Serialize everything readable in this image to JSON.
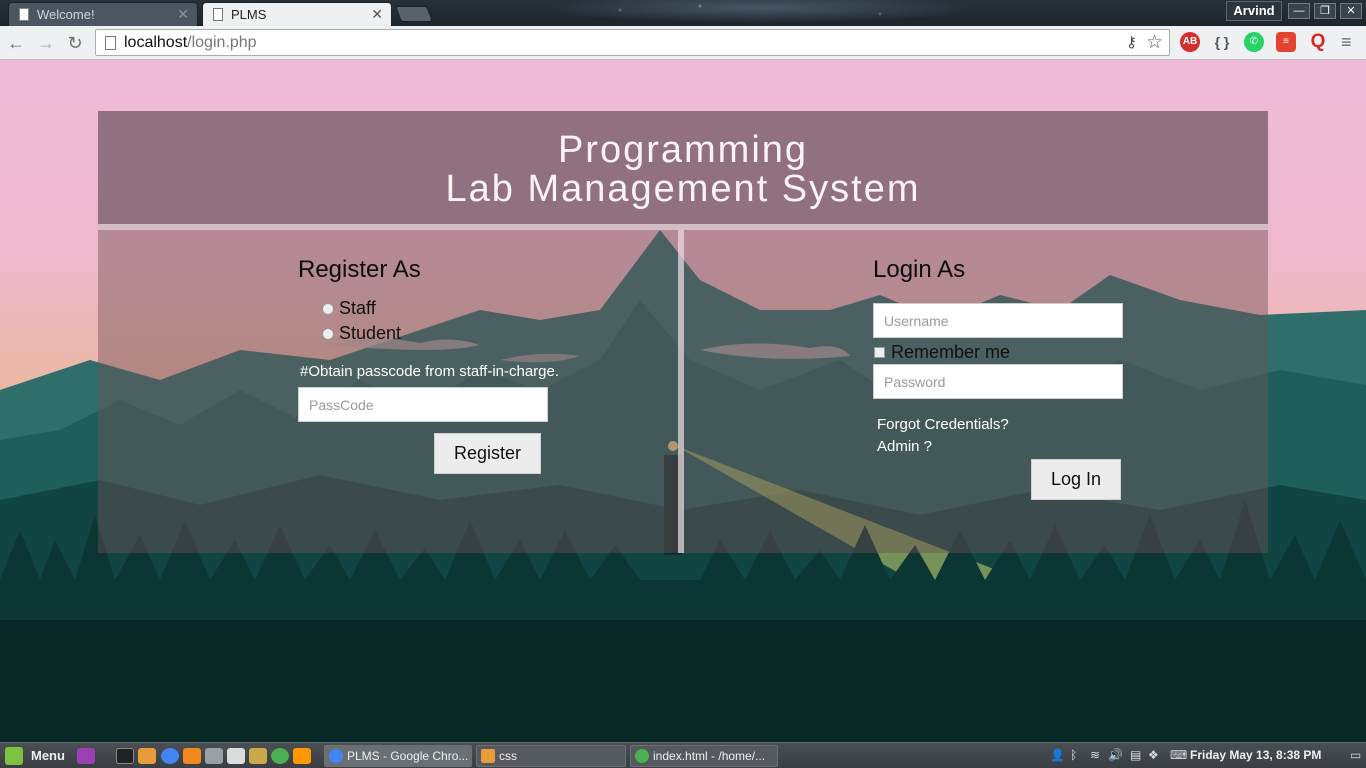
{
  "browser": {
    "tabs": [
      {
        "title": "Welcome!",
        "active": false
      },
      {
        "title": "PLMS",
        "active": true
      }
    ],
    "user": "Arvind",
    "url_host": "localhost",
    "url_path": "/login.php"
  },
  "header": {
    "title_line1": "Programming",
    "title_line2": "Lab Management System"
  },
  "register": {
    "title": "Register As",
    "options": [
      "Staff",
      "Student"
    ],
    "note": "#Obtain passcode from staff-in-charge.",
    "passcode_placeholder": "PassCode",
    "button": "Register"
  },
  "login": {
    "title": "Login As",
    "username_placeholder": "Username",
    "remember_label": "Remember me",
    "password_placeholder": "Password",
    "forgot_link": "Forgot Credentials?",
    "admin_link": "Admin ?",
    "button": "Log In"
  },
  "taskbar": {
    "menu_label": "Menu",
    "tasks": [
      "PLMS - Google Chro...",
      "css",
      "index.html - /home/..."
    ],
    "clock": "Friday May 13,  8:38 PM"
  }
}
